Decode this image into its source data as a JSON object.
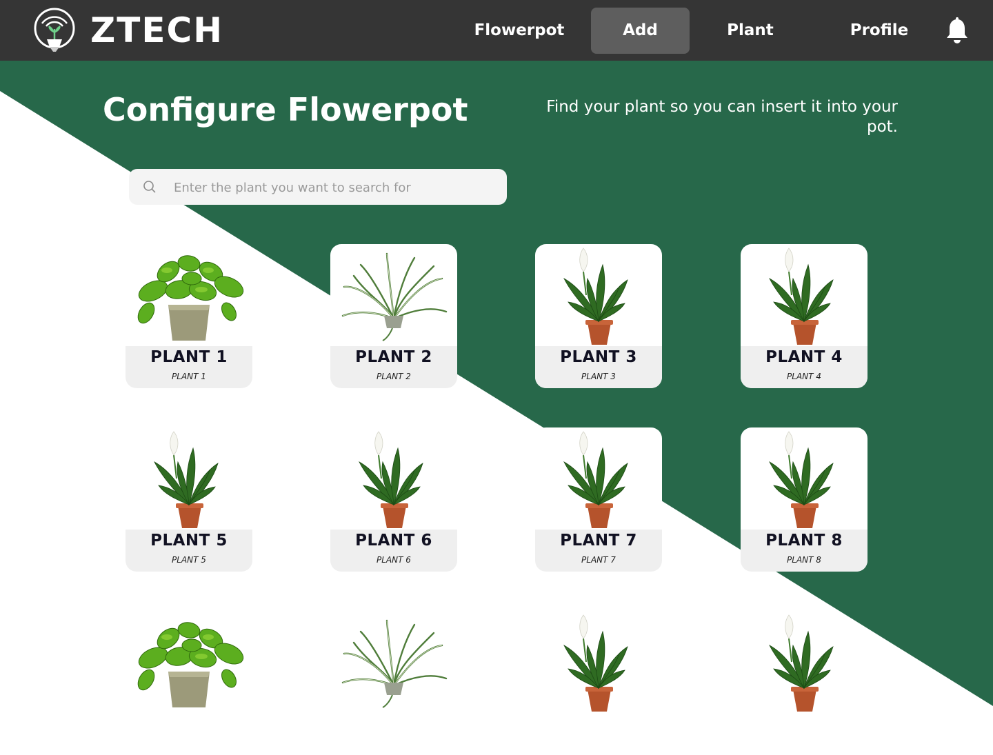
{
  "brand": {
    "name": "ZTECH"
  },
  "nav": {
    "items": [
      {
        "label": "Flowerpot",
        "active": false
      },
      {
        "label": "Add",
        "active": true
      },
      {
        "label": "Plant",
        "active": false
      },
      {
        "label": "Profile",
        "active": false
      }
    ],
    "notification_icon": "bell-icon"
  },
  "page": {
    "title": "Configure Flowerpot",
    "subtitle": "Find your plant so you can insert it into your pot."
  },
  "search": {
    "placeholder": "Enter the plant you want to search for",
    "value": "",
    "icon": "search-icon"
  },
  "plants": [
    {
      "name": "PLANT 1",
      "sub": "PLANT 1",
      "kind": "pothos"
    },
    {
      "name": "PLANT 2",
      "sub": "PLANT 2",
      "kind": "spider"
    },
    {
      "name": "PLANT 3",
      "sub": "PLANT 3",
      "kind": "peace-lily"
    },
    {
      "name": "PLANT 4",
      "sub": "PLANT 4",
      "kind": "peace-lily"
    },
    {
      "name": "PLANT 5",
      "sub": "PLANT 5",
      "kind": "peace-lily"
    },
    {
      "name": "PLANT 6",
      "sub": "PLANT 6",
      "kind": "peace-lily"
    },
    {
      "name": "PLANT 7",
      "sub": "PLANT 7",
      "kind": "peace-lily"
    },
    {
      "name": "PLANT 8",
      "sub": "PLANT 8",
      "kind": "peace-lily"
    },
    {
      "kind": "pothos"
    },
    {
      "kind": "spider"
    },
    {
      "kind": "peace-lily"
    },
    {
      "kind": "peace-lily"
    }
  ],
  "colors": {
    "header": "#353535",
    "green": "#27684a",
    "active_nav": "#5e5e5e",
    "card_label": "#efefef"
  }
}
